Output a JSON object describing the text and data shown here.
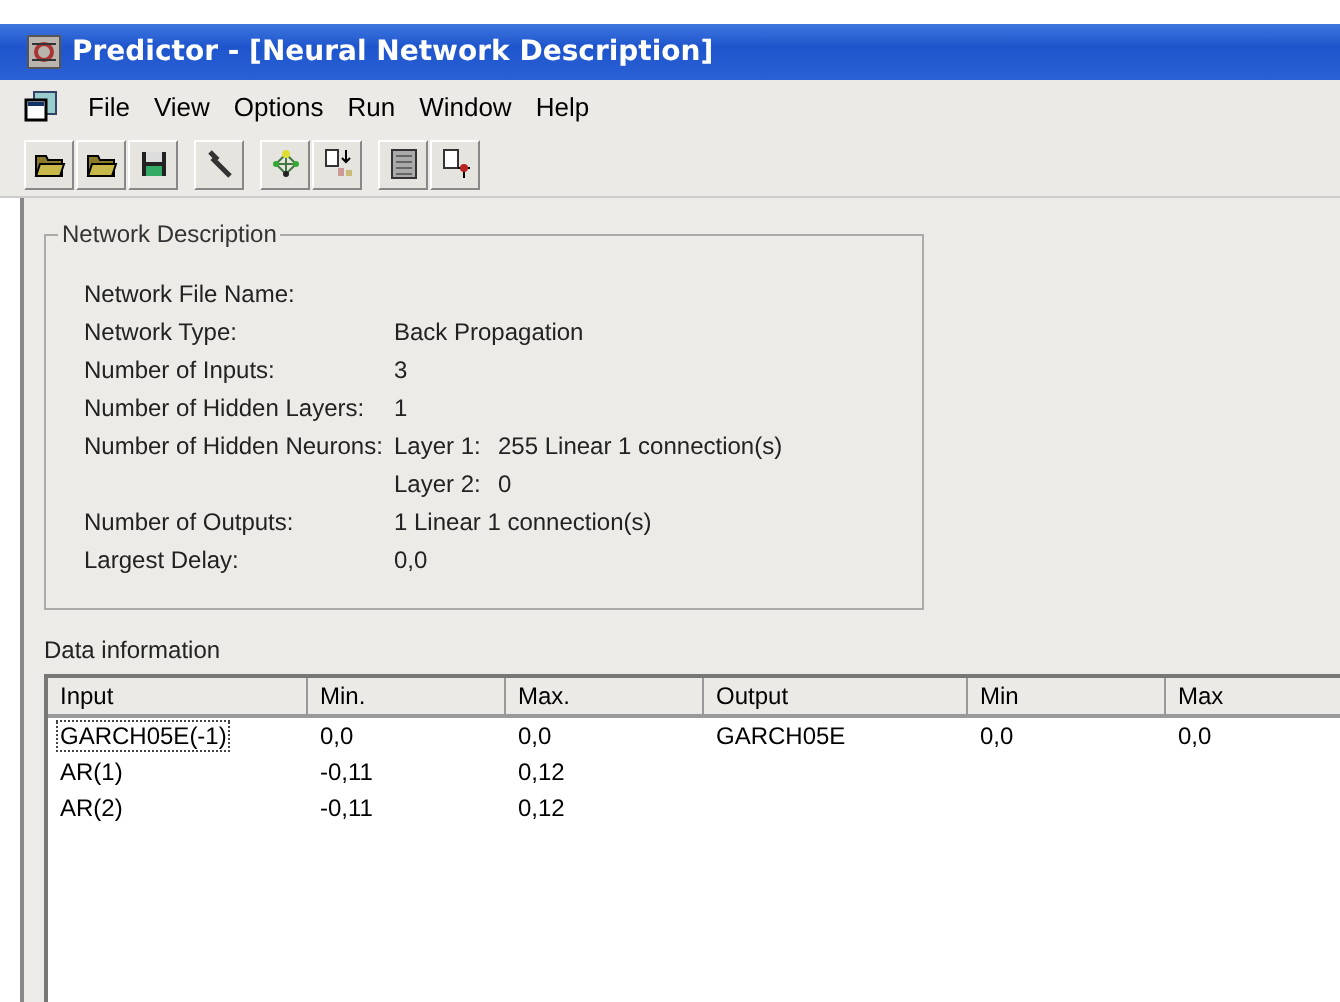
{
  "window": {
    "title": "Predictor - [Neural Network Description]"
  },
  "menu": [
    "File",
    "View",
    "Options",
    "Run",
    "Window",
    "Help"
  ],
  "network_description": {
    "title": "Network Description",
    "rows": [
      {
        "label": "Network File Name:",
        "values": []
      },
      {
        "label": "Network Type:",
        "values": [
          "Back Propagation"
        ]
      },
      {
        "label": "Number of Inputs:",
        "values": [
          "3"
        ]
      },
      {
        "label": "Number of Hidden Layers:",
        "values": [
          "1"
        ]
      },
      {
        "label": "Number of Hidden Neurons:",
        "values": [
          "Layer 1:",
          "255 Linear 1 connection(s)"
        ]
      },
      {
        "label": "",
        "values": [
          "Layer 2:",
          "0"
        ]
      },
      {
        "label": "Number of Outputs:",
        "values": [
          "1 Linear 1 connection(s)"
        ]
      },
      {
        "label": "Largest Delay:",
        "values": [
          "0,0"
        ]
      }
    ]
  },
  "data_information": {
    "title": "Data information",
    "columns": [
      "Input",
      "Min.",
      "Max.",
      "Output",
      "Min",
      "Max"
    ],
    "rows": [
      {
        "cells": [
          "GARCH05E(-1)",
          "0,0",
          "0,0",
          "GARCH05E",
          "0,0",
          "0,0"
        ],
        "selected": true
      },
      {
        "cells": [
          "AR(1)",
          "-0,11",
          "0,12"
        ],
        "selected": false
      },
      {
        "cells": [
          "AR(2)",
          "-0,11",
          "0,12"
        ],
        "selected": false
      }
    ]
  }
}
